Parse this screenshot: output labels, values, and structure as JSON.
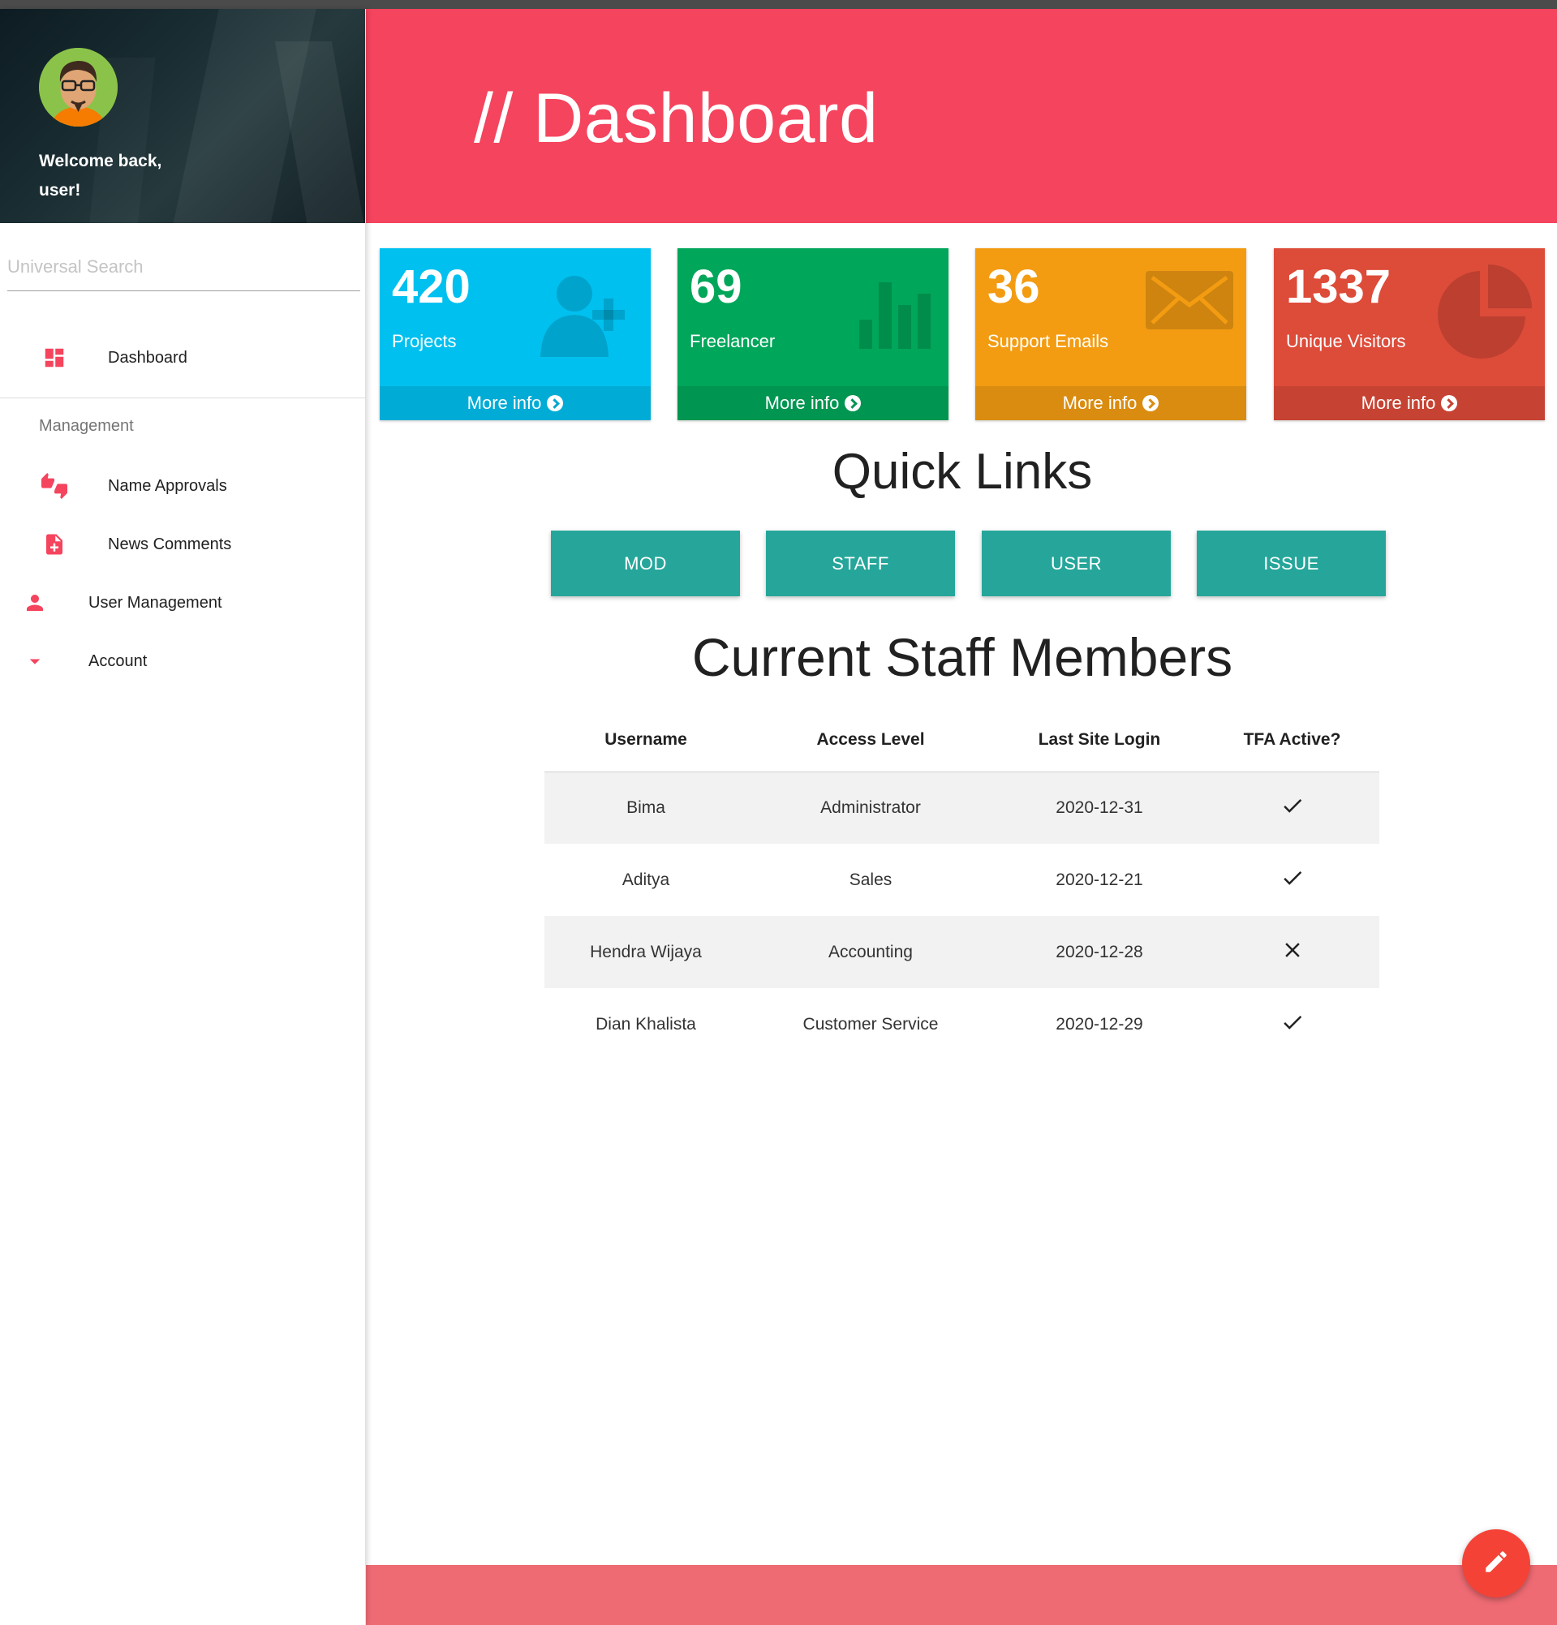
{
  "sidebar": {
    "welcome_line1": "Welcome back,",
    "welcome_line2": "user!",
    "avatar_icon": "user-avatar-icon",
    "search": {
      "placeholder": "Universal Search",
      "value": ""
    },
    "items": {
      "dashboard": {
        "label": "Dashboard",
        "icon": "dashboard-icon"
      },
      "management_header": "Management",
      "name_approvals": {
        "label": "Name Approvals",
        "icon": "thumbs-up-down-icon"
      },
      "news_comments": {
        "label": "News Comments",
        "icon": "note-add-icon"
      },
      "user_management": {
        "label": "User Management",
        "icon": "person-icon"
      },
      "account": {
        "label": "Account",
        "icon": "arrow-drop-down-icon"
      }
    },
    "accent_color": "#f5445e"
  },
  "header": {
    "title": "// Dashboard",
    "background_color": "#f5445e"
  },
  "stats": [
    {
      "value": "420",
      "label": "Projects",
      "more": "More info",
      "color": "#00c0ef",
      "icon": "user-plus-icon"
    },
    {
      "value": "69",
      "label": "Freelancer",
      "more": "More info",
      "color": "#00a65a",
      "icon": "bar-chart-icon"
    },
    {
      "value": "36",
      "label": "Support Emails",
      "more": "More info",
      "color": "#f39c12",
      "icon": "envelope-icon"
    },
    {
      "value": "1337",
      "label": "Unique Visitors",
      "more": "More info",
      "color": "#dd4b39",
      "icon": "pie-chart-icon"
    }
  ],
  "quick_links": {
    "title": "Quick Links",
    "buttons": [
      "MOD",
      "STAFF",
      "USER",
      "ISSUE"
    ],
    "button_color": "#26a69a"
  },
  "staff": {
    "title": "Current Staff Members",
    "columns": [
      "Username",
      "Access Level",
      "Last Site Login",
      "TFA Active?"
    ],
    "rows": [
      {
        "username": "Bima",
        "access": "Administrator",
        "login": "2020-12-31",
        "tfa": true
      },
      {
        "username": "Aditya",
        "access": "Sales",
        "login": "2020-12-21",
        "tfa": true
      },
      {
        "username": "Hendra Wijaya",
        "access": "Accounting",
        "login": "2020-12-28",
        "tfa": false
      },
      {
        "username": "Dian Khalista",
        "access": "Customer Service",
        "login": "2020-12-29",
        "tfa": true
      }
    ]
  },
  "fab": {
    "icon": "pencil-edit-icon",
    "color": "#f44336"
  },
  "footer": {
    "color": "#ef6b74"
  }
}
